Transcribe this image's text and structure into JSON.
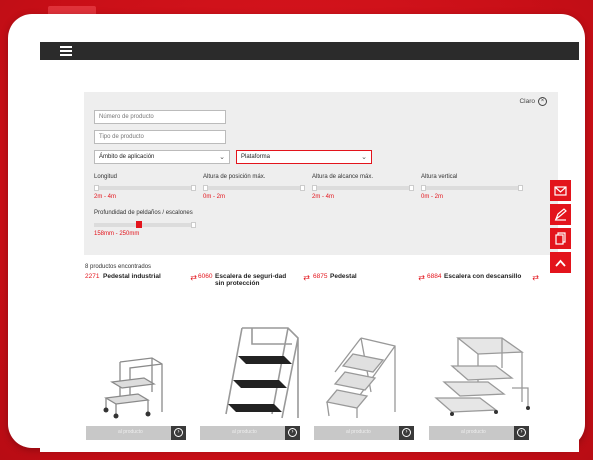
{
  "filter": {
    "clear_label": "Claro",
    "product_number_placeholder": "Número de producto",
    "product_type_placeholder": "Tipo de producto",
    "application_select": "Ámbito de aplicación",
    "platform_select": "Plataforma",
    "length_label": "Longitud",
    "length_range": "2m - 4m",
    "position_height_label": "Altura de posición máx.",
    "position_height_range": "0m - 2m",
    "reach_height_label": "Altura de alcance máx.",
    "reach_height_range": "2m - 4m",
    "vertical_height_label": "Altura vertical",
    "vertical_height_range": "0m - 2m",
    "step_depth_label": "Profundidad de peldaños / escalones",
    "step_depth_range": "158mm - 250mm"
  },
  "results": {
    "count_text": "8 productos encontrados",
    "products": [
      {
        "number": "2271",
        "name": "Pedestal industrial"
      },
      {
        "number": "6060",
        "name": "Escalera de seguri-dad sin protección"
      },
      {
        "number": "6875",
        "name": "Pedestal"
      },
      {
        "number": "6884",
        "name": "Escalera con descansillo"
      }
    ],
    "button_label": "al producto"
  },
  "colors": {
    "accent": "#e3141c",
    "topbar": "#2b2b2b",
    "panel": "#eeeeee"
  }
}
